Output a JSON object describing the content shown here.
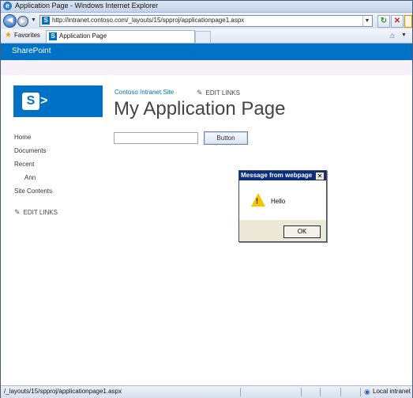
{
  "window": {
    "title": "Application Page - Windows Internet Explorer"
  },
  "addressbar": {
    "url": "http://intranet.contoso.com/_layouts/15/spproj/applicationpage1.aspx"
  },
  "favorites": {
    "label": "Favorites",
    "tab_label": "Application Page"
  },
  "suitebar": {
    "brand": "SharePoint"
  },
  "header": {
    "site_link": "Contoso Intranet Site",
    "edit_links": "EDIT LINKS",
    "page_title": "My Application Page"
  },
  "quicklaunch": {
    "items": [
      "Home",
      "Documents",
      "Recent",
      "Ann",
      "Site Contents"
    ],
    "edit_links": "EDIT LINKS"
  },
  "form": {
    "textbox_value": "",
    "button_label": "Button"
  },
  "dialog": {
    "title": "Message from webpage",
    "message": "Hello",
    "ok_label": "OK",
    "close_glyph": "✕"
  },
  "statusbar": {
    "url": "/_layouts/15/spproj/applicationpage1.aspx",
    "zone": "Local intranet"
  },
  "icons": {
    "ie": "ie-logo-icon",
    "back": "back-arrow-icon",
    "forward": "forward-arrow-icon",
    "refresh": "refresh-icon",
    "stop": "stop-icon",
    "search": "search-icon",
    "favorites": "star-icon",
    "home": "home-icon",
    "sharepoint": "sharepoint-logo-icon",
    "edit": "pencil-icon",
    "warning": "warning-icon",
    "zone": "intranet-zone-icon"
  },
  "colors": {
    "suitebar": "#0072c6",
    "dialog_title": "#0b2c7c",
    "link": "#0072c6"
  }
}
